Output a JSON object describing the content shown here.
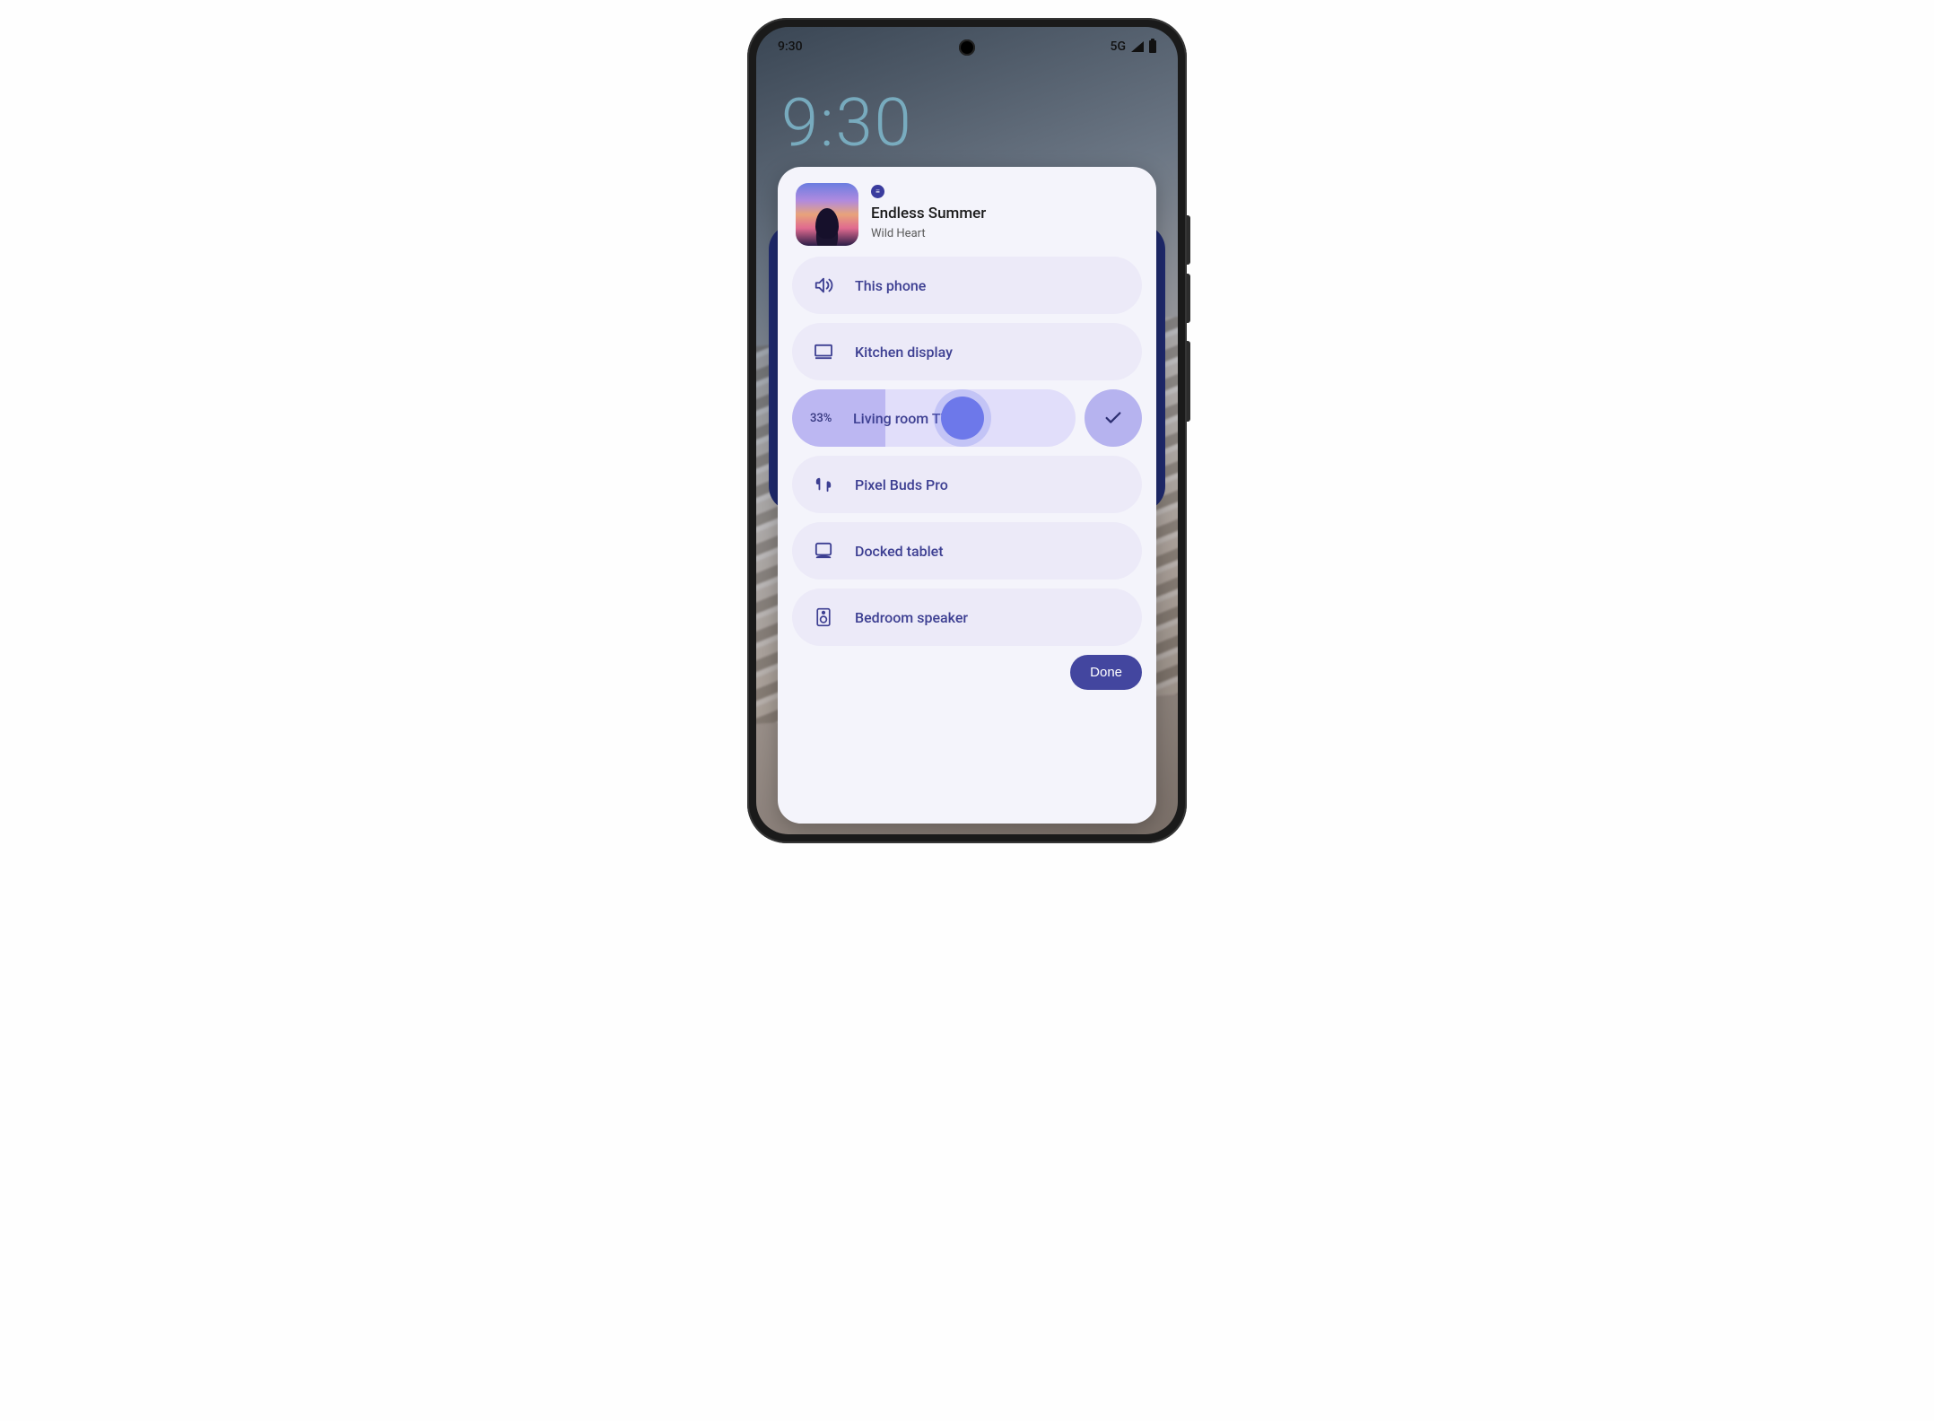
{
  "status_bar": {
    "time": "9:30",
    "network": "5G"
  },
  "lockscreen": {
    "clock": "9:30"
  },
  "media": {
    "app_icon": "spotify-icon",
    "track_title": "Endless Summer",
    "track_artist": "Wild Heart"
  },
  "output_switcher": {
    "devices": [
      {
        "id": "this-phone",
        "icon": "volume-icon",
        "label": "This phone",
        "active": false
      },
      {
        "id": "kitchen-display",
        "icon": "display-icon",
        "label": "Kitchen display",
        "active": false
      },
      {
        "id": "living-room-tv",
        "icon": "tv-icon",
        "label": "Living room TV",
        "active": true,
        "volume_percent": 33,
        "volume_label": "33%"
      },
      {
        "id": "pixel-buds-pro",
        "icon": "earbuds-icon",
        "label": "Pixel Buds Pro",
        "active": false
      },
      {
        "id": "docked-tablet",
        "icon": "tablet-icon",
        "label": "Docked tablet",
        "active": false
      },
      {
        "id": "bedroom-speaker",
        "icon": "speaker-icon",
        "label": "Bedroom speaker",
        "active": false
      }
    ],
    "done_label": "Done"
  },
  "colors": {
    "accent": "#43469f",
    "row_bg": "#eceaf8",
    "row_active_bg": "#e1defa",
    "volume_fill": "#bcb7f2",
    "knob": "#6d78ea",
    "check_bg": "#b6b3ef"
  }
}
